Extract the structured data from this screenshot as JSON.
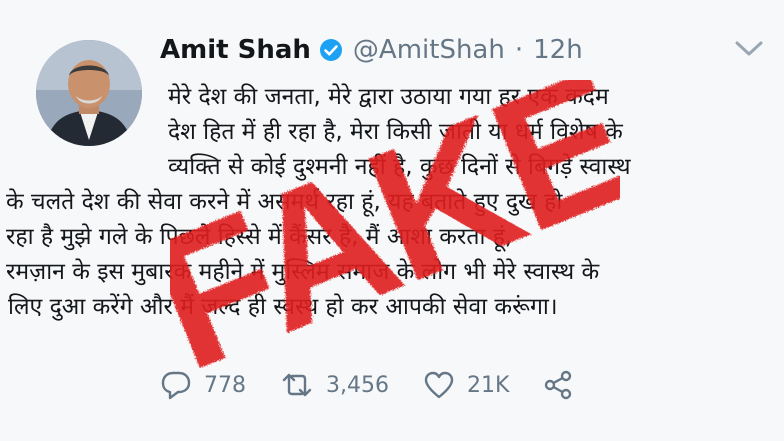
{
  "tweet": {
    "display_name": "Amit Shah",
    "handle": "@AmitShah",
    "separator": "·",
    "time": "12h",
    "text_lines": [
      "मेरे देश की जनता, मेरे द्वारा उठाया गया हर एक कदम",
      "देश हित में ही रहा है, मेरा किसी जाती या धर्म विशेष के",
      "व्यक्ति से कोई दुश्मनी नहीं है, कुछ दिनों से बिगड़े स्वास्थ",
      "के चलते देश की सेवा करने में असमर्थ रहा हूं, यह बताते हुए दुख हो",
      "रहा है मुझे गले के पिछले हिस्से में कैंसर है, मैं आशा करता हूं,",
      "रमज़ान के इस मुबारक महीने में मुस्लिम समाज के लोग भी मेरे स्वास्थ के",
      "लिए दुआ करेंगे और मैं जल्द ही स्वस्थ हो कर आपकी सेवा करूंगा।"
    ],
    "reply_count": "778",
    "retweet_count": "3,456",
    "like_count": "21K"
  },
  "overlay": {
    "stamp_text": "FAKE",
    "stamp_color": "#e01e1e"
  },
  "colors": {
    "text": "#14171a",
    "muted": "#657786",
    "verified": "#1da1f2"
  },
  "icons": [
    "verified-badge-icon",
    "chevron-down-icon",
    "reply-icon",
    "retweet-icon",
    "like-icon",
    "share-icon"
  ]
}
